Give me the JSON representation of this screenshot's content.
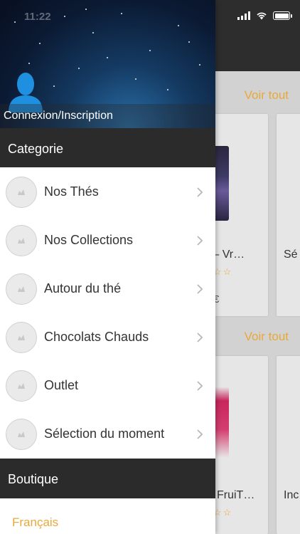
{
  "status_bar": {
    "time": "11:22"
  },
  "drawer": {
    "login_label": "Connexion/Inscription",
    "category_header": "Categorie",
    "items": [
      {
        "label": "Nos Thés"
      },
      {
        "label": "Nos Collections"
      },
      {
        "label": "Autour du thé"
      },
      {
        "label": "Chocolats Chauds"
      },
      {
        "label": "Outlet"
      },
      {
        "label": "Sélection du moment"
      }
    ],
    "shop_header": "Boutique",
    "language": "Français"
  },
  "background": {
    "see_all_label": "Voir tout",
    "section1_cards": [
      {
        "title": "n – Vr…",
        "price": "€",
        "stars": "☆☆"
      },
      {
        "title": "Sé"
      }
    ],
    "section2_cards": [
      {
        "title": "FruiT…",
        "stars": "☆☆"
      },
      {
        "title": "Inc"
      }
    ]
  },
  "colors": {
    "accent": "#e9a93a",
    "section_bg": "#2b2b2b",
    "nav_bg": "#2d2d2d"
  }
}
